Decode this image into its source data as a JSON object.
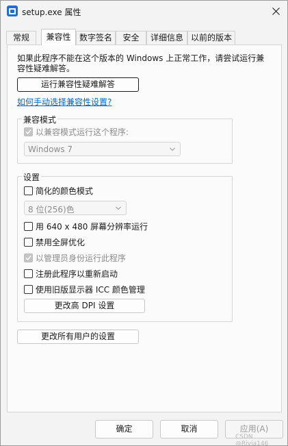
{
  "window": {
    "title": "setup.exe 属性"
  },
  "tabs": [
    {
      "label": "常规",
      "active": false
    },
    {
      "label": "兼容性",
      "active": true
    },
    {
      "label": "数字签名",
      "active": false
    },
    {
      "label": "安全",
      "active": false
    },
    {
      "label": "详细信息",
      "active": false
    },
    {
      "label": "以前的版本",
      "active": false
    }
  ],
  "compat": {
    "description": "如果此程序不能在这个版本的 Windows 上正常工作，请尝试运行兼容性疑难解答。",
    "run_troubleshooter": "运行兼容性疑难解答",
    "manual_link": "如何手动选择兼容性设置?",
    "mode_group": "兼容模式",
    "mode_checkbox": "以兼容模式运行这个程序:",
    "mode_checkbox_checked": true,
    "mode_select_value": "Windows 7",
    "settings_group": "设置",
    "reduced_color": "简化的颜色模式",
    "color_select_value": "8 位(256)色",
    "res_640": "用 640 x 480 屏幕分辨率运行",
    "disable_fullscreen": "禁用全屏优化",
    "run_as_admin": "以管理员身份运行此程序",
    "register_restart": "注册此程序以重新启动",
    "legacy_icc": "使用旧版显示器 ICC 颜色管理",
    "dpi_button": "更改高 DPI 设置",
    "all_users_button": "更改所有用户的设置"
  },
  "footer": {
    "ok": "确定",
    "cancel": "取消",
    "apply": "应用(A)",
    "watermark": "CSDN @Rivia146"
  },
  "colors": {
    "link": "#0067c0",
    "disabled_text": "#8c8c8c",
    "icon_blue": "#1f6fd1"
  }
}
